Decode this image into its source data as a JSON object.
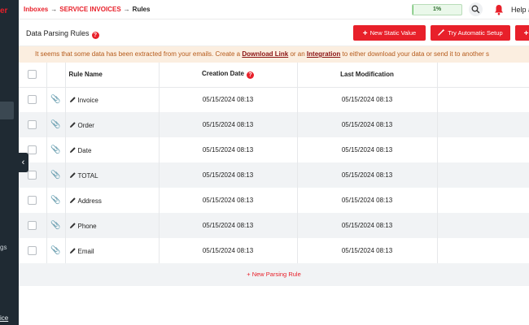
{
  "sidebar": {
    "brand_fragment": "er",
    "item_fragment_gs": "gs",
    "item_fragment_ice": "ice"
  },
  "topbar": {
    "breadcrumb": [
      "Inboxes",
      "SERVICE INVOICES",
      "Rules"
    ],
    "progress": {
      "label": "1%",
      "value": 0.01
    },
    "help_label": "Help a"
  },
  "header": {
    "title": "Data Parsing Rules",
    "info_symbol": "?",
    "buttons": {
      "new_static": "New Static Value",
      "try_auto": "Try Automatic Setup",
      "third": ""
    }
  },
  "notice": {
    "text_before": "It seems that some data has been extracted from your emails. Create a ",
    "link1": "Download Link",
    "text_middle": " or an ",
    "link2": "Integration",
    "text_after": " to either download your data or send it to another s"
  },
  "table": {
    "headers": {
      "name": "Rule Name",
      "created": "Creation Date",
      "modified": "Last Modification"
    },
    "rows": [
      {
        "name": "Invoice",
        "created": "05/15/2024 08:13",
        "modified": "05/15/2024 08:13"
      },
      {
        "name": "Order",
        "created": "05/15/2024 08:13",
        "modified": "05/15/2024 08:13"
      },
      {
        "name": "Date",
        "created": "05/15/2024 08:13",
        "modified": "05/15/2024 08:13"
      },
      {
        "name": "TOTAL",
        "created": "05/15/2024 08:13",
        "modified": "05/15/2024 08:13"
      },
      {
        "name": "Address",
        "created": "05/15/2024 08:13",
        "modified": "05/15/2024 08:13"
      },
      {
        "name": "Phone",
        "created": "05/15/2024 08:13",
        "modified": "05/15/2024 08:13"
      },
      {
        "name": "Email",
        "created": "05/15/2024 08:13",
        "modified": "05/15/2024 08:13"
      }
    ],
    "new_rule_label": "+ New Parsing Rule"
  },
  "colors": {
    "accent": "#e8202a",
    "sidebar": "#1f2a33",
    "notice_bg": "#fbeee0",
    "row_alt": "#f1f3f5"
  },
  "icons": [
    "search-icon",
    "bell-icon",
    "info-icon",
    "plus-icon",
    "wand-icon",
    "paperclip-icon",
    "pencil-icon",
    "chevron-left-icon"
  ]
}
